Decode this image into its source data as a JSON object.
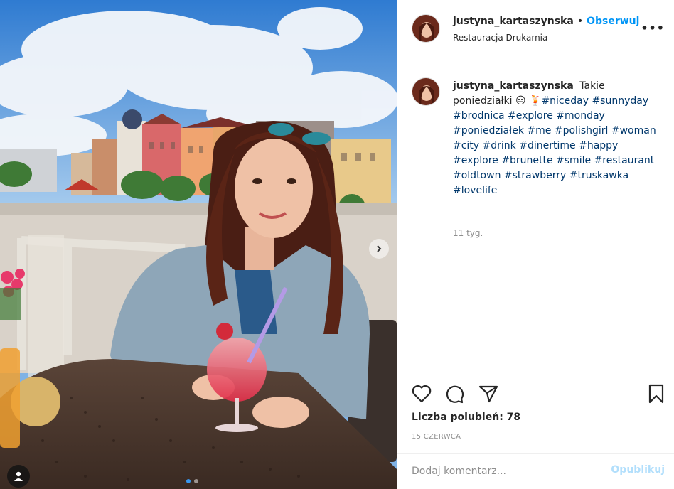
{
  "post": {
    "username": "justyna_kartaszynska",
    "follow_label": "Obserwuj",
    "location": "Restauracja Drukarnia",
    "more_label": "•••"
  },
  "caption": {
    "username": "justyna_kartaszynska",
    "text": "Takie poniedziałki 😑 🍹",
    "hashtags": [
      "#niceday",
      "#sunnyday",
      "#brodnica",
      "#explore",
      "#monday",
      "#poniedziałek",
      "#me",
      "#polishgirl",
      "#woman",
      "#city",
      "#drink",
      "#dinertime",
      "#happy",
      "#explore",
      "#brunette",
      "#smile",
      "#restaurant",
      "#oldtown",
      "#strawberry",
      "#truskawka",
      "#lovelife"
    ],
    "age": "11 tyg."
  },
  "actions": {
    "icons": [
      "heart-icon",
      "comment-icon",
      "share-icon",
      "bookmark-icon"
    ],
    "likes": "Liczba polubień: 78",
    "date": "15 CZERWCA"
  },
  "comment": {
    "placeholder": "Dodaj komentarz...",
    "publish_label": "Opublikuj"
  },
  "photo": {
    "carousel_slides": 2,
    "active_slide": 1
  },
  "colors": {
    "accent": "#0095f6",
    "hashtag": "#00376b",
    "muted": "#8e8e8e",
    "publish_disabled": "#b2dffc"
  }
}
